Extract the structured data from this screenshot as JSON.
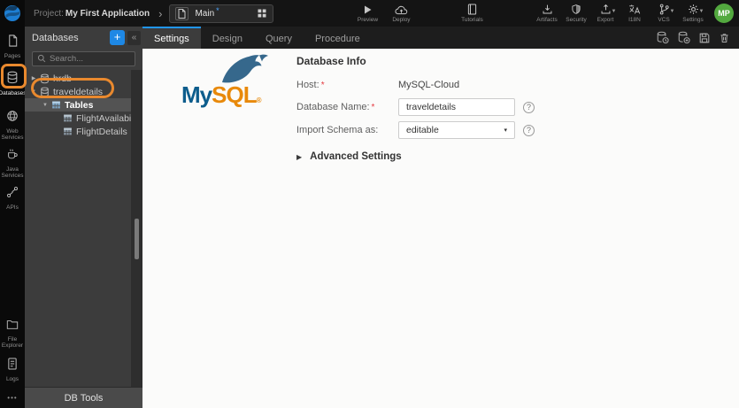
{
  "colors": {
    "accent_blue": "#2196f3",
    "annotation_orange": "#e9892e",
    "avatar_green": "#53a93f",
    "mysql_blue": "#0d5d8c",
    "mysql_orange": "#e8890a"
  },
  "glyphs": {
    "collapsed": "▶",
    "expanded": "▼",
    "panel_collapse": "«",
    "breadcrumb_chevron": "›",
    "dropdown_arrow": "▾",
    "more_dots": "•••",
    "help": "?",
    "advanced_arrow": "▶",
    "dirty": "*",
    "plus": "+"
  },
  "header": {
    "project_label": "Project:",
    "project_name": "My First Application",
    "page_tab": {
      "label": "Main"
    },
    "preview_label": "Preview",
    "deploy_label": "Deploy",
    "tutorials_label": "Tutorials",
    "artifacts_label": "Artifacts",
    "security_label": "Security",
    "export_label": "Export",
    "i18n_label": "I18N",
    "vcs_label": "VCS",
    "settings_label": "Settings",
    "avatar_initials": "MP"
  },
  "activity_bar": {
    "items": [
      {
        "label": "Pages"
      },
      {
        "label": "Databases",
        "active": true
      },
      {
        "label": "Web Services"
      },
      {
        "label": "Java Services"
      },
      {
        "label": "APIs"
      }
    ],
    "bottom_items": [
      {
        "label": "File Explorer"
      },
      {
        "label": "Logs"
      }
    ]
  },
  "db_panel": {
    "title": "Databases",
    "search_placeholder": "Search...",
    "tree": {
      "items": [
        {
          "label": "hrdb",
          "type": "database",
          "state": "collapsed"
        },
        {
          "label": "traveldetails",
          "type": "database",
          "state": "expanded"
        },
        {
          "label": "Tables",
          "type": "tables-folder",
          "state": "expanded",
          "selected": true
        },
        {
          "label": "FlightAvailability",
          "type": "table"
        },
        {
          "label": "FlightDetails",
          "type": "table"
        }
      ]
    },
    "footer_label": "DB Tools"
  },
  "workspace": {
    "tabs": [
      {
        "label": "Settings",
        "active": true
      },
      {
        "label": "Design"
      },
      {
        "label": "Query"
      },
      {
        "label": "Procedure"
      }
    ]
  },
  "database_info": {
    "title": "Database Info",
    "brand": {
      "my": "My",
      "sql": "SQL",
      "reg": "®"
    },
    "required_marker": "*",
    "fields": [
      {
        "label": "Host:",
        "required": true,
        "value": "MySQL-Cloud",
        "type": "static"
      },
      {
        "label": "Database Name:",
        "required": true,
        "value": "traveldetails",
        "type": "input"
      },
      {
        "label": "Import Schema as:",
        "required": false,
        "value": "editable",
        "type": "select"
      }
    ],
    "advanced_settings_label": "Advanced Settings"
  }
}
